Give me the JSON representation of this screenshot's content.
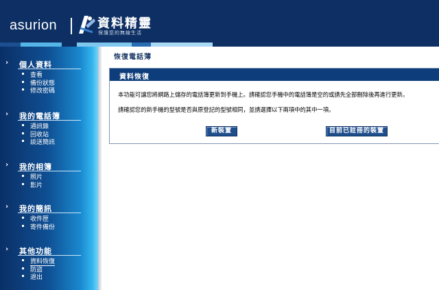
{
  "header": {
    "brand": "asurion",
    "product_name": "資料精靈",
    "tagline": "保護您的無線生活",
    "stripe_colors": [
      "#1b4f8f",
      "#55b4e8",
      "#0d2f63",
      "#7fc7ef",
      "#2b6db2",
      "#a9d9f5",
      "#0d2f63"
    ]
  },
  "sidebar": {
    "sections": [
      {
        "title": "個人資料",
        "items": [
          "查看",
          "備份狀態",
          "修改密碼"
        ]
      },
      {
        "title": "我的電話簿",
        "items": [
          "通訊錄",
          "回收站",
          "談送簡訊"
        ]
      },
      {
        "title": "我的相簿",
        "items": [
          "照片",
          "影片"
        ]
      },
      {
        "title": "我的簡訊",
        "items": [
          "收件匣",
          "寄件備份"
        ]
      },
      {
        "title": "其他功能",
        "items": [
          "資料恢復",
          "防盜",
          "退出"
        ]
      }
    ],
    "arrow_glyph": "›",
    "active_item": "資料恢復"
  },
  "main": {
    "page_title": "恢復電話薄",
    "panel": {
      "heading": "資料恢復",
      "paragraph1": "本功能可讓您將網路上儲存的電話簿更新到手機上。請確認您手機中的電話簿是空的或請先全部刪除後再進行更新。",
      "paragraph2": "請確認您的新手機的型號是否與原登記的型號相同，並請選擇以下兩項中的其中一項。",
      "btn_new_device": "新裝置",
      "btn_registered_device": "目前已註冊的裝置"
    }
  }
}
